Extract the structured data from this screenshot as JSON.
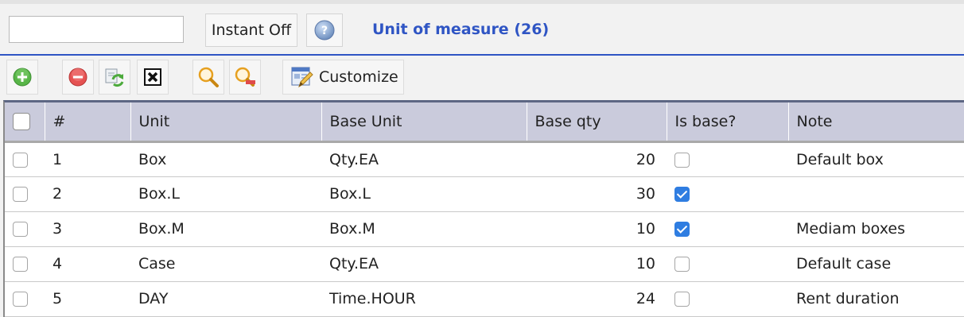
{
  "header": {
    "search_value": "",
    "instant_label": "Instant Off",
    "help_icon": "help-icon",
    "title_text": "Unit of measure",
    "title_count": "(26)",
    "accent_color": "#2f55c4"
  },
  "toolbar": {
    "buttons": [
      {
        "name": "add",
        "icon": "add-icon",
        "color": "#52b043"
      },
      {
        "name": "delete",
        "icon": "delete-icon",
        "color": "#e04b4b"
      },
      {
        "name": "refresh",
        "icon": "refresh-icon",
        "color": "#4caa3c"
      },
      {
        "name": "clear",
        "icon": "clear-icon",
        "color": "#111111"
      },
      {
        "name": "search",
        "icon": "search-icon",
        "color": "#e6a020"
      },
      {
        "name": "search-remove",
        "icon": "search-remove-icon",
        "color": "#e04b4b"
      }
    ],
    "customize_label": "Customize",
    "customize_icon": "customize-icon"
  },
  "grid": {
    "columns": [
      "#",
      "Unit",
      "Base Unit",
      "Base qty",
      "Is base?",
      "Note"
    ],
    "header_bg": "#cacbdc",
    "rows": [
      {
        "num": "1",
        "unit": "Box",
        "base_unit": "Qty.EA",
        "base_qty": "20",
        "is_base": false,
        "note": "Default box"
      },
      {
        "num": "2",
        "unit": "Box.L",
        "base_unit": "Box.L",
        "base_qty": "30",
        "is_base": true,
        "note": ""
      },
      {
        "num": "3",
        "unit": "Box.M",
        "base_unit": "Box.M",
        "base_qty": "10",
        "is_base": true,
        "note": "Mediam boxes"
      },
      {
        "num": "4",
        "unit": "Case",
        "base_unit": "Qty.EA",
        "base_qty": "10",
        "is_base": false,
        "note": "Default case"
      },
      {
        "num": "5",
        "unit": "DAY",
        "base_unit": "Time.HOUR",
        "base_qty": "24",
        "is_base": false,
        "note": "Rent duration"
      }
    ]
  }
}
